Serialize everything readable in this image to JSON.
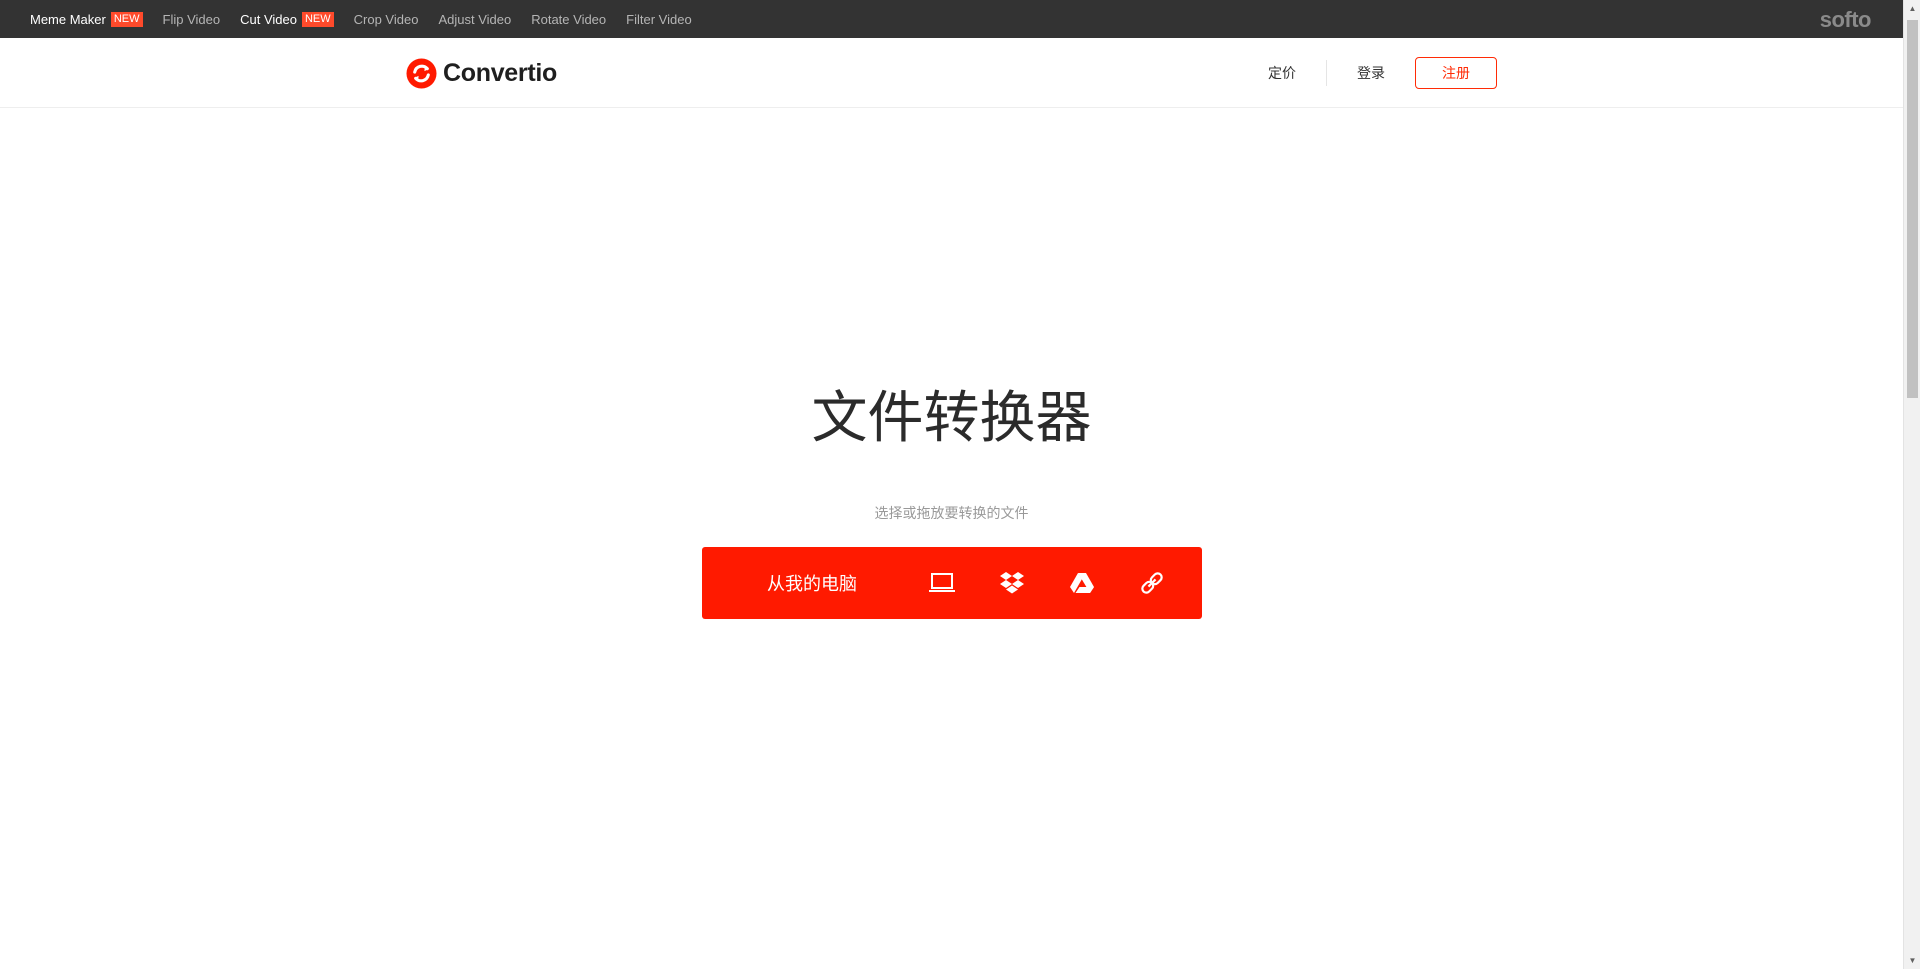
{
  "promo_bar": {
    "links": [
      {
        "label": "Meme Maker",
        "badge": "NEW",
        "highlight": true
      },
      {
        "label": "Flip Video",
        "badge": "",
        "highlight": false
      },
      {
        "label": "Cut Video",
        "badge": "NEW",
        "highlight": true
      },
      {
        "label": "Crop Video",
        "badge": "",
        "highlight": false
      },
      {
        "label": "Adjust Video",
        "badge": "",
        "highlight": false
      },
      {
        "label": "Rotate Video",
        "badge": "",
        "highlight": false
      },
      {
        "label": "Filter Video",
        "badge": "",
        "highlight": false
      }
    ],
    "brand": "softo"
  },
  "header": {
    "logo_text": "Convertio",
    "pricing_label": "定价",
    "login_label": "登录",
    "signup_label": "注册"
  },
  "hero": {
    "title": "文件转换器",
    "subtitle": "选择或拖放要转换的文件",
    "choose_label": "从我的电脑",
    "source_icons": [
      "laptop-icon",
      "dropbox-icon",
      "google-drive-icon",
      "link-icon"
    ]
  },
  "colors": {
    "accent": "#ff1a00",
    "topbar_bg": "#333333",
    "badge": "#ff4a2b"
  }
}
